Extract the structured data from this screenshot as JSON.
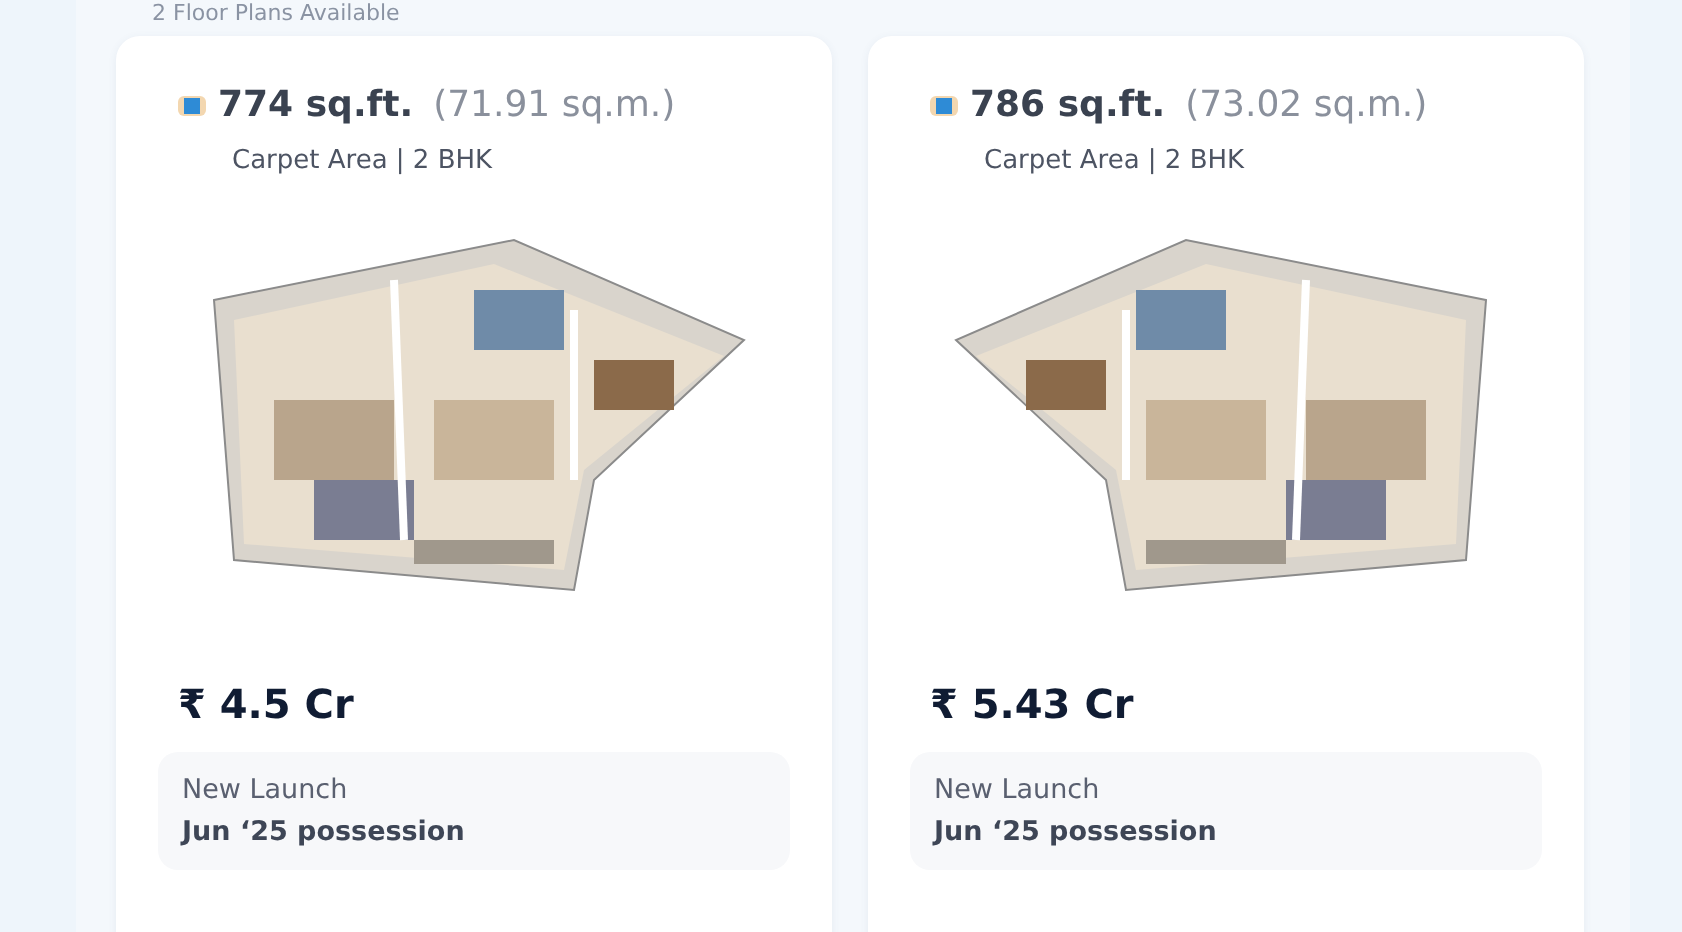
{
  "heading": "2 Floor Plans Available",
  "plans": [
    {
      "area": "774 sq.ft.",
      "area_metric": "(71.91 sq.m.)",
      "type": "Carpet Area | 2 BHK",
      "price": "₹ 4.5 Cr",
      "status": "New Launch",
      "possession": "Jun ‘25 possession"
    },
    {
      "area": "786 sq.ft.",
      "area_metric": "(73.02 sq.m.)",
      "type": "Carpet Area | 2 BHK",
      "price": "₹ 5.43 Cr",
      "status": "New Launch",
      "possession": "Jun ‘25 possession"
    }
  ]
}
